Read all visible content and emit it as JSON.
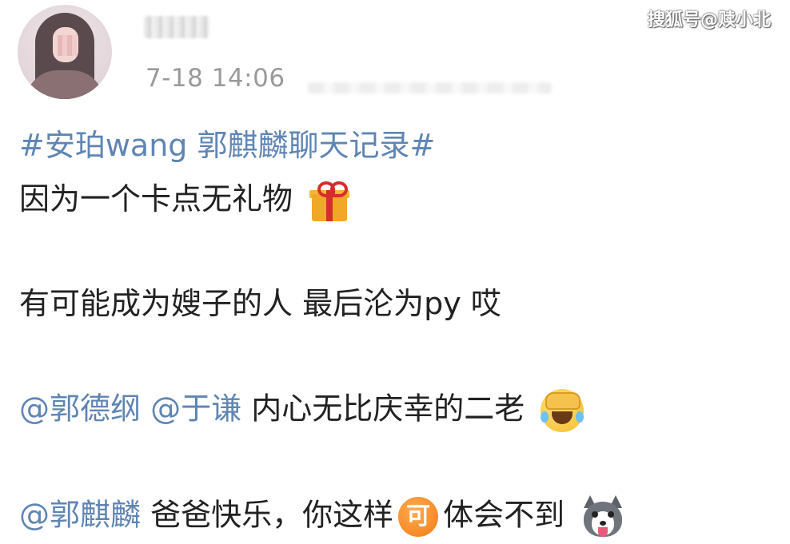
{
  "post": {
    "timestamp": "7-18 14:06",
    "watermark": "搜狐号@赎小北",
    "lines": {
      "line1": {
        "hashtag": "#安珀wang 郭麒麟聊天记录#"
      },
      "line2": {
        "text": "因为一个卡点无礼物",
        "emoji": "gift-icon"
      },
      "line3": {
        "text": "有可能成为嫂子的人 最后沦为py 哎"
      },
      "line4": {
        "mention1": "@郭德纲",
        "mention2": "@于谦",
        "text": "内心无比庆幸的二老",
        "emoji": "laughing-crying-icon"
      },
      "line5": {
        "mention": "@郭麒麟",
        "text_before": "爸爸快乐，你这样",
        "ke_icon_label": "可",
        "text_after": "体会不到",
        "emoji": "husky-icon"
      }
    }
  },
  "colors": {
    "link": "#5f85b3",
    "text": "#222222",
    "timestamp": "#9a9a9a"
  }
}
